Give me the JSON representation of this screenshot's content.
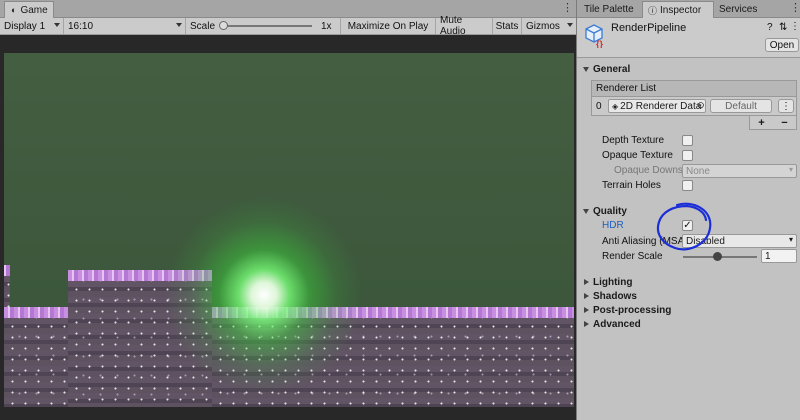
{
  "game": {
    "tab_label": "Game",
    "toolbar": {
      "display": "Display 1",
      "aspect": "16:10",
      "scale_label": "Scale",
      "scale_value": "1x",
      "maximize_on_play": "Maximize On Play",
      "mute_audio": "Mute Audio",
      "stats": "Stats",
      "gizmos": "Gizmos"
    }
  },
  "inspector": {
    "tabs": [
      {
        "label": "Tile Palette"
      },
      {
        "label": "Inspector"
      },
      {
        "label": "Services"
      }
    ],
    "asset_name": "RenderPipeline",
    "open_button": "Open",
    "general": {
      "title": "General",
      "renderer_list_label": "Renderer List",
      "renderer_index": "0",
      "renderer_name": "2D Renderer Data",
      "renderer_default": "Default",
      "add": "+",
      "remove": "−",
      "depth_texture": "Depth Texture",
      "opaque_texture": "Opaque Texture",
      "opaque_downsampling": "Opaque Downsa",
      "opaque_downsampling_value": "None",
      "terrain_holes": "Terrain Holes"
    },
    "quality": {
      "title": "Quality",
      "hdr": "HDR",
      "hdr_checked": true,
      "anti_aliasing": "Anti Aliasing (MSA",
      "anti_aliasing_value": "Disabled",
      "render_scale": "Render Scale",
      "render_scale_value": "1"
    },
    "collapsed_sections": [
      "Lighting",
      "Shadows",
      "Post-processing",
      "Advanced"
    ]
  },
  "colors": {
    "hdr_label": "#1f5fbf",
    "annotation": "#1c2fd6",
    "light": "#7cff7c"
  }
}
